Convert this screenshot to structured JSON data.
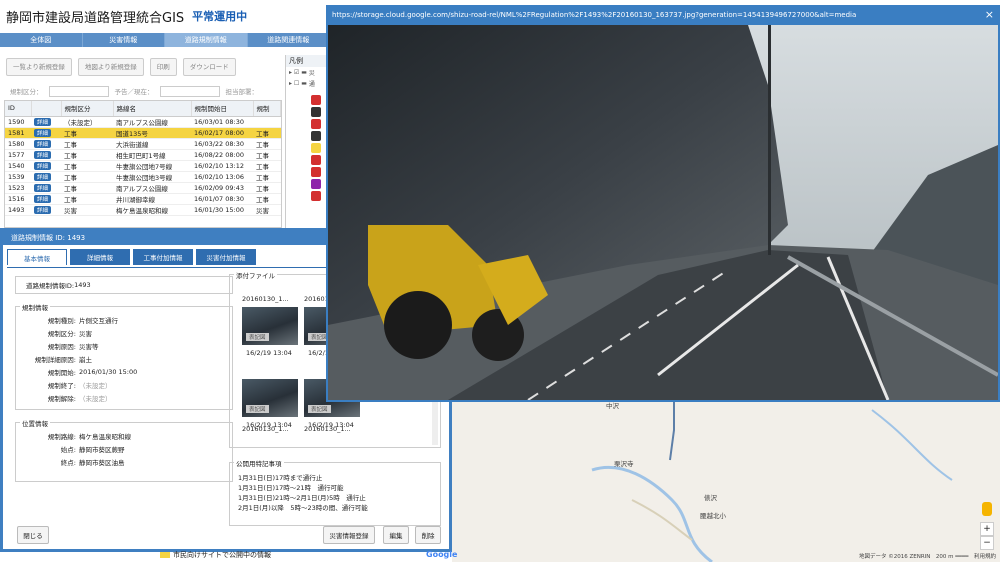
{
  "header": {
    "title": "静岡市建設局道路管理統合GIS",
    "status": "平常運用中"
  },
  "top_tabs": [
    "全体図",
    "災害情報",
    "道路規制情報",
    "道路関連情報"
  ],
  "toolbar": [
    "一覧より新規登録",
    "地図より新規登録",
    "印刷",
    "ダウンロード"
  ],
  "filters": {
    "category": "規制区分：",
    "schedule": "予告／現在：",
    "department": "担当部署："
  },
  "grid": {
    "columns": [
      "ID",
      "",
      "規制区分",
      "路線名",
      "規制開始日",
      "規制"
    ],
    "detail_label": "詳細",
    "rows": [
      {
        "id": "1590",
        "cat": "（未設定）",
        "route": "南アルプス公園線",
        "start": "16/03/01 08:30",
        "reg": "",
        "selected": false
      },
      {
        "id": "1581",
        "cat": "工事",
        "route": "国道135号",
        "start": "16/02/17 08:00",
        "reg": "工事",
        "selected": true
      },
      {
        "id": "1580",
        "cat": "工事",
        "route": "大浜街道線",
        "start": "16/03/22 08:30",
        "reg": "工事",
        "selected": false
      },
      {
        "id": "1577",
        "cat": "工事",
        "route": "相生町巴町1号線",
        "start": "16/08/22 08:00",
        "reg": "工事",
        "selected": false
      },
      {
        "id": "1540",
        "cat": "工事",
        "route": "牛妻旗公団地7号線",
        "start": "16/02/10 13:12",
        "reg": "工事",
        "selected": false
      },
      {
        "id": "1539",
        "cat": "工事",
        "route": "牛妻旗公団地3号線",
        "start": "16/02/10 13:06",
        "reg": "工事",
        "selected": false
      },
      {
        "id": "1523",
        "cat": "工事",
        "route": "南アルプス公園線",
        "start": "16/02/09 09:43",
        "reg": "工事",
        "selected": false
      },
      {
        "id": "1516",
        "cat": "工事",
        "route": "井川湖御幸線",
        "start": "16/01/07 08:30",
        "reg": "工事",
        "selected": false
      },
      {
        "id": "1493",
        "cat": "災害",
        "route": "梅ケ島温泉昭和線",
        "start": "16/01/30 15:00",
        "reg": "災害",
        "selected": false
      }
    ]
  },
  "legend": {
    "title": "凡例",
    "rows": [
      "災",
      "通"
    ],
    "icon_colors": [
      "#d32f2f",
      "#333333",
      "#d32f2f",
      "#333333",
      "#f5d442",
      "#d32f2f",
      "#d32f2f",
      "#8e24aa",
      "#d32f2f"
    ]
  },
  "detail": {
    "title": "道路規制情報 ID: 1493",
    "tabs": [
      "基本情報",
      "詳細情報",
      "工事付加情報",
      "災害付加情報"
    ],
    "id_label": "道路規制情報ID:",
    "id_value": "1493",
    "reg_section": "規制情報",
    "fields": [
      {
        "k": "規制種別:",
        "v": "片側交互通行",
        "gray": false
      },
      {
        "k": "規制区分:",
        "v": "災害",
        "gray": false
      },
      {
        "k": "規制原因:",
        "v": "災害等",
        "gray": false
      },
      {
        "k": "規制詳細原因:",
        "v": "崩土",
        "gray": false
      },
      {
        "k": "規制開始:",
        "v": "2016/01/30 15:00",
        "gray": false
      },
      {
        "k": "規制終了:",
        "v": "（未設定）",
        "gray": true
      },
      {
        "k": "規制解除:",
        "v": "（未設定）",
        "gray": true
      }
    ],
    "loc_section": "位置情報",
    "loc_fields": [
      {
        "k": "規制路線:",
        "v": "梅ケ島温泉昭和線"
      },
      {
        "k": "始点:",
        "v": "静岡市葵区蕨野"
      },
      {
        "k": "終点:",
        "v": "静岡市葵区油島"
      }
    ],
    "attach_section": "添付ファイル",
    "thumbs": [
      {
        "name": "20160130_1...",
        "date": "16/2/19 13:04",
        "tag": "表記図"
      },
      {
        "name": "20160130_1...",
        "date": "16/2/19 13:04",
        "tag": "表記図"
      },
      {
        "name": "",
        "date": "16/2/19 13:04",
        "tag": "表記図"
      },
      {
        "name": "",
        "date": "16/2/19 13:04",
        "tag": "表記図"
      },
      {
        "name": "20160130_1...",
        "date": "",
        "tag": ""
      },
      {
        "name": "20160130_1...",
        "date": "",
        "tag": ""
      }
    ],
    "public_section": "公開用特記事項",
    "public_text": "1月31日(日)17時まで通行止\n1月31日(日)17時～21時　通行可能\n1月31日(日)21時～2月1日(月)5時　通行止\n2月1日(月)以降　5時～23時の間、通行可能",
    "buttons": {
      "close": "閉じる",
      "disaster": "災害情報登録",
      "edit": "編集",
      "delete": "削除"
    }
  },
  "popup": {
    "url": "https://storage.cloud.google.com/shizu-road-rel/NML%2FRegulation%2F1493%2F20160130_163737.jpg?generation=1454139496727000&alt=media",
    "close": "×"
  },
  "map": {
    "labels": [
      "中沢",
      "栗沢寺",
      "俵沢",
      "腰越北小"
    ],
    "zoom_in": "+",
    "zoom_out": "−",
    "footer": "地図データ ©2016 ZENRIN　200 m ━━━━　利用規約",
    "google": "Google"
  },
  "public_info": "市民向けサイトで公開中の情報"
}
